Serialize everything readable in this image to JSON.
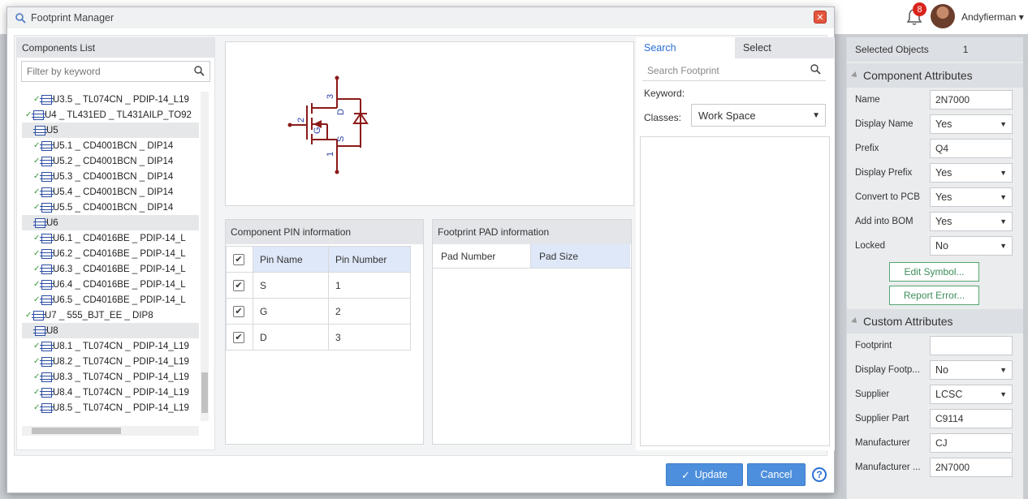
{
  "app": {
    "notification_count": "8",
    "username": "Andyfierman"
  },
  "modal": {
    "title": "Footprint Manager",
    "close_symbol": "✕",
    "update_label": "Update",
    "cancel_label": "Cancel",
    "help_symbol": "?"
  },
  "components_list": {
    "title": "Components List",
    "filter_placeholder": "Filter by keyword",
    "rows": [
      {
        "text": "U3.5 _ TL074CN _ PDIP-14_L19",
        "group": false,
        "check": true,
        "indent": 2
      },
      {
        "text": "U4 _ TL431ED _ TL431AILP_TO92",
        "group": false,
        "check": true,
        "indent": 1
      },
      {
        "text": "U5",
        "group": true,
        "check": false,
        "indent": 1
      },
      {
        "text": "U5.1 _ CD4001BCN _ DIP14",
        "group": false,
        "check": true,
        "indent": 2
      },
      {
        "text": "U5.2 _ CD4001BCN _ DIP14",
        "group": false,
        "check": true,
        "indent": 2
      },
      {
        "text": "U5.3 _ CD4001BCN _ DIP14",
        "group": false,
        "check": true,
        "indent": 2
      },
      {
        "text": "U5.4 _ CD4001BCN _ DIP14",
        "group": false,
        "check": true,
        "indent": 2
      },
      {
        "text": "U5.5 _ CD4001BCN _ DIP14",
        "group": false,
        "check": true,
        "indent": 2
      },
      {
        "text": "U6",
        "group": true,
        "check": false,
        "indent": 1
      },
      {
        "text": "U6.1 _ CD4016BE _ PDIP-14_L",
        "group": false,
        "check": true,
        "indent": 2
      },
      {
        "text": "U6.2 _ CD4016BE _ PDIP-14_L",
        "group": false,
        "check": true,
        "indent": 2
      },
      {
        "text": "U6.3 _ CD4016BE _ PDIP-14_L",
        "group": false,
        "check": true,
        "indent": 2
      },
      {
        "text": "U6.4 _ CD4016BE _ PDIP-14_L",
        "group": false,
        "check": true,
        "indent": 2
      },
      {
        "text": "U6.5 _ CD4016BE _ PDIP-14_L",
        "group": false,
        "check": true,
        "indent": 2
      },
      {
        "text": "U7 _ 555_BJT_EE _ DIP8",
        "group": false,
        "check": true,
        "indent": 1
      },
      {
        "text": "U8",
        "group": true,
        "check": false,
        "indent": 1
      },
      {
        "text": "U8.1 _ TL074CN _ PDIP-14_L19",
        "group": false,
        "check": true,
        "indent": 2
      },
      {
        "text": "U8.2 _ TL074CN _ PDIP-14_L19",
        "group": false,
        "check": true,
        "indent": 2
      },
      {
        "text": "U8.3 _ TL074CN _ PDIP-14_L19",
        "group": false,
        "check": true,
        "indent": 2
      },
      {
        "text": "U8.4 _ TL074CN _ PDIP-14_L19",
        "group": false,
        "check": true,
        "indent": 2
      },
      {
        "text": "U8.5 _ TL074CN _ PDIP-14_L19",
        "group": false,
        "check": true,
        "indent": 2
      }
    ]
  },
  "symbol": {
    "pin_labels": {
      "d": "D",
      "g": "G",
      "s": "S"
    },
    "pin_numbers": {
      "p1": "1",
      "p2": "2",
      "p3": "3"
    },
    "color": "#8b1a1a",
    "text_color": "#2b3fa8"
  },
  "pin_info": {
    "title": "Component PIN information",
    "header_checked": "✔",
    "columns": [
      "Pin Name",
      "Pin Number"
    ],
    "rows": [
      {
        "checked": "✔",
        "name": "S",
        "number": "1"
      },
      {
        "checked": "✔",
        "name": "G",
        "number": "2"
      },
      {
        "checked": "✔",
        "name": "D",
        "number": "3"
      }
    ]
  },
  "pad_info": {
    "title": "Footprint PAD information",
    "columns": [
      "Pad Number",
      "Pad Size"
    ]
  },
  "search_panel": {
    "tabs": [
      "Search",
      "Select"
    ],
    "search_placeholder": "Search Footprint",
    "keyword_label": "Keyword:",
    "classes_label": "Classes:",
    "classes_value": "Work Space"
  },
  "properties": {
    "selected_label": "Selected Objects",
    "selected_count": "1",
    "component_title": "Component Attributes",
    "component_rows": [
      {
        "label": "Name",
        "value": "2N7000",
        "type": "input"
      },
      {
        "label": "Display Name",
        "value": "Yes",
        "type": "select"
      },
      {
        "label": "Prefix",
        "value": "Q4",
        "type": "input"
      },
      {
        "label": "Display Prefix",
        "value": "Yes",
        "type": "select"
      },
      {
        "label": "Convert to PCB",
        "value": "Yes",
        "type": "select"
      },
      {
        "label": "Add into BOM",
        "value": "Yes",
        "type": "select"
      },
      {
        "label": "Locked",
        "value": "No",
        "type": "select"
      }
    ],
    "edit_symbol_label": "Edit Symbol...",
    "report_error_label": "Report Error...",
    "custom_title": "Custom Attributes",
    "custom_rows": [
      {
        "label": "Footprint",
        "value": "",
        "type": "input"
      },
      {
        "label": "Display Footp...",
        "value": "No",
        "type": "select"
      },
      {
        "label": "Supplier",
        "value": "LCSC",
        "type": "select"
      },
      {
        "label": "Supplier Part",
        "value": "C9114",
        "type": "input"
      },
      {
        "label": "Manufacturer",
        "value": "CJ",
        "type": "input"
      },
      {
        "label": "Manufacturer ...",
        "value": "2N7000",
        "type": "input"
      }
    ]
  },
  "colors": {
    "accent": "#2a6fd6",
    "button": "#4d8fdc",
    "green": "#3d8e5b"
  }
}
